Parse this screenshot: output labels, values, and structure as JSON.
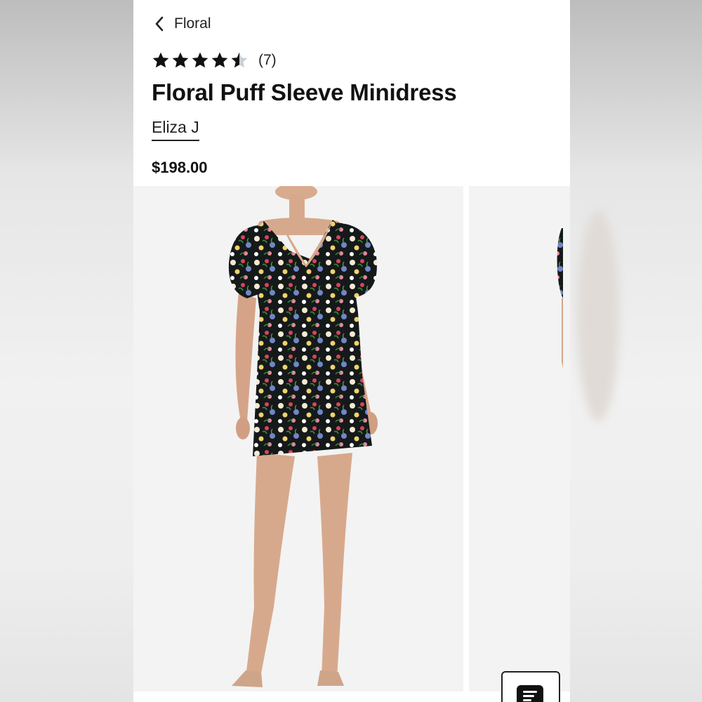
{
  "nav": {
    "back_label": "Floral"
  },
  "rating": {
    "stars": 4.5,
    "max": 5,
    "count_text": "(7)"
  },
  "product": {
    "title": "Floral Puff Sleeve Minidress",
    "brand": "Eliza J",
    "price": "$198.00"
  },
  "colors": {
    "star_fill": "#111111",
    "star_empty": "#c9cfd3",
    "background": "#ffffff",
    "photo_bg": "#f3f3f3"
  },
  "icons": {
    "back": "chevron-left-icon",
    "chat": "chat-icon"
  }
}
